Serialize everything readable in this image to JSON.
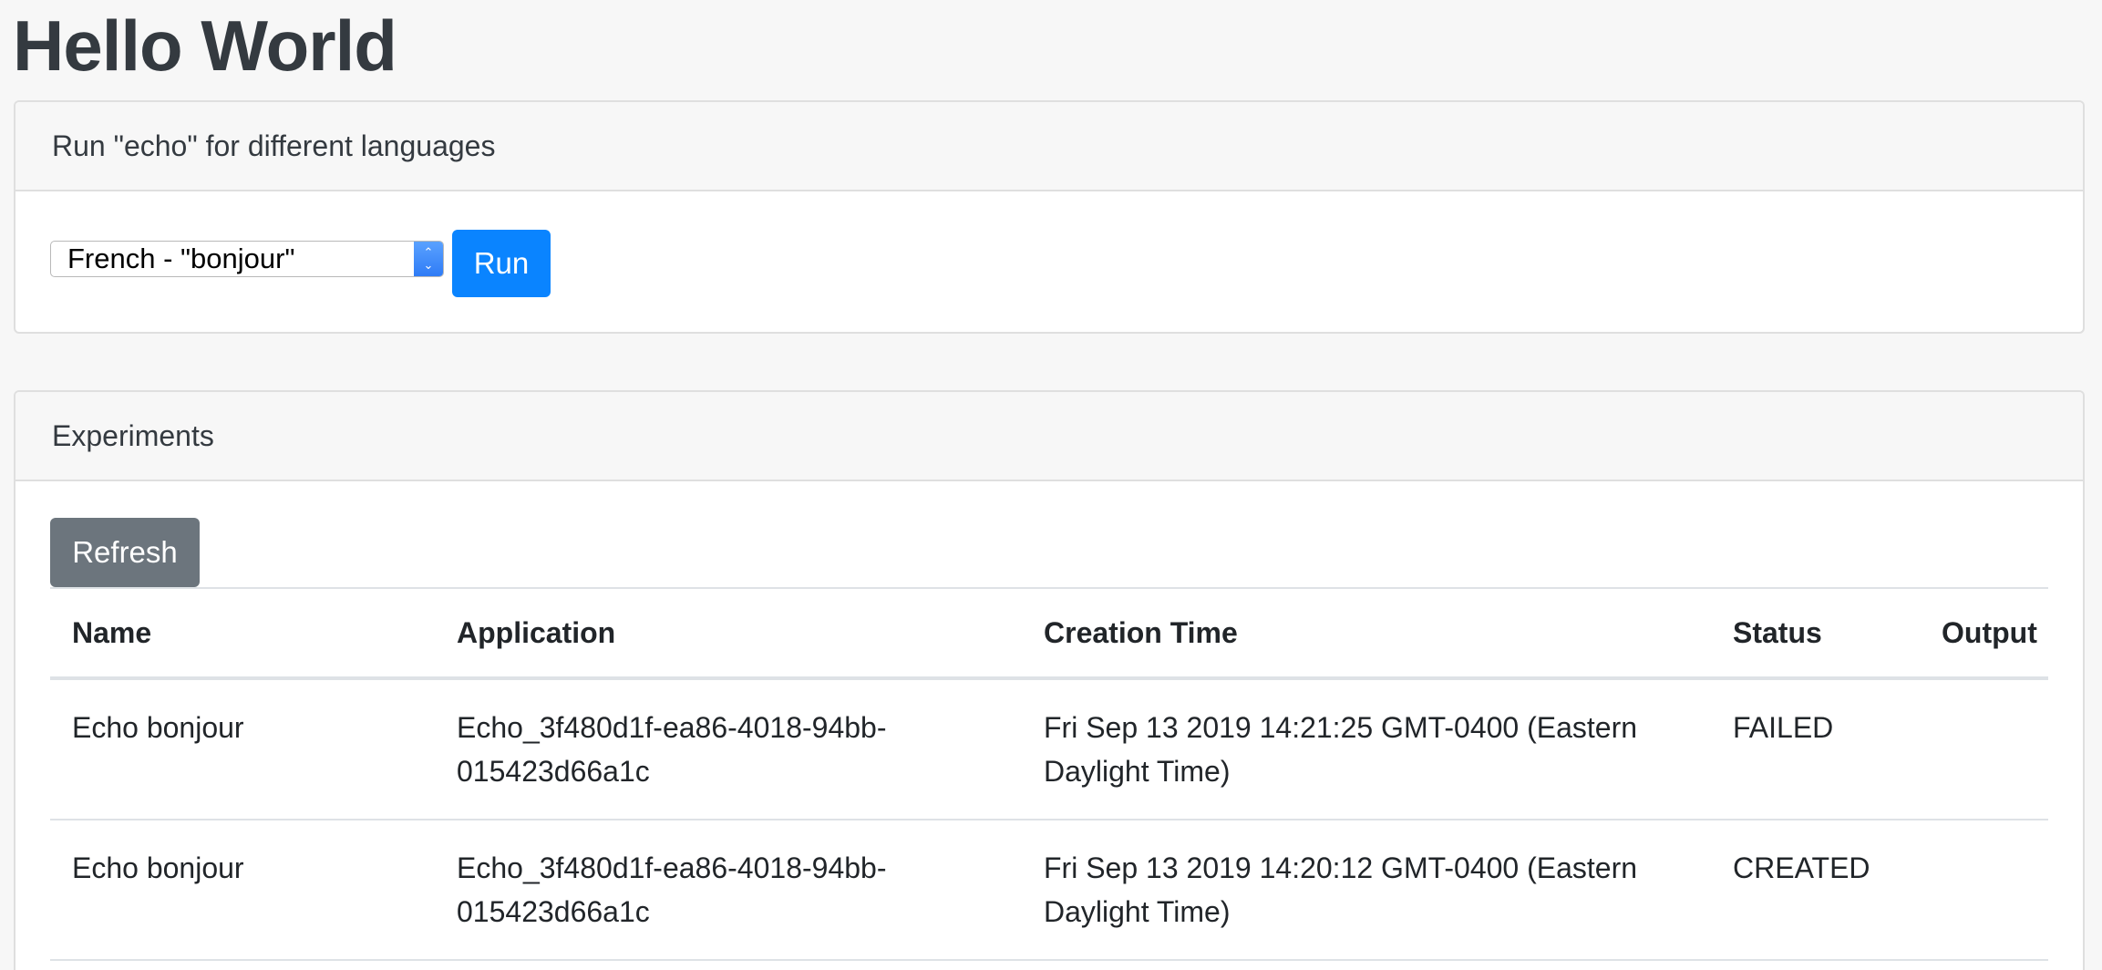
{
  "page": {
    "title": "Hello World"
  },
  "run_card": {
    "header": "Run \"echo\" for different languages",
    "select_value": "French - \"bonjour\"",
    "run_label": "Run"
  },
  "experiments_card": {
    "header": "Experiments",
    "refresh_label": "Refresh",
    "columns": [
      "Name",
      "Application",
      "Creation Time",
      "Status",
      "Output"
    ],
    "rows": [
      {
        "name": "Echo bonjour",
        "application": "Echo_3f480d1f-ea86-4018-94bb-015423d66a1c",
        "creation_time": "Fri Sep 13 2019 14:21:25 GMT-0400 (Eastern Daylight Time)",
        "status": "FAILED",
        "output": ""
      },
      {
        "name": "Echo bonjour",
        "application": "Echo_3f480d1f-ea86-4018-94bb-015423d66a1c",
        "creation_time": "Fri Sep 13 2019 14:20:12 GMT-0400 (Eastern Daylight Time)",
        "status": "CREATED",
        "output": ""
      }
    ]
  },
  "colors": {
    "primary": "#0a84ff",
    "secondary": "#6c757d",
    "background": "#f7f7f7"
  }
}
